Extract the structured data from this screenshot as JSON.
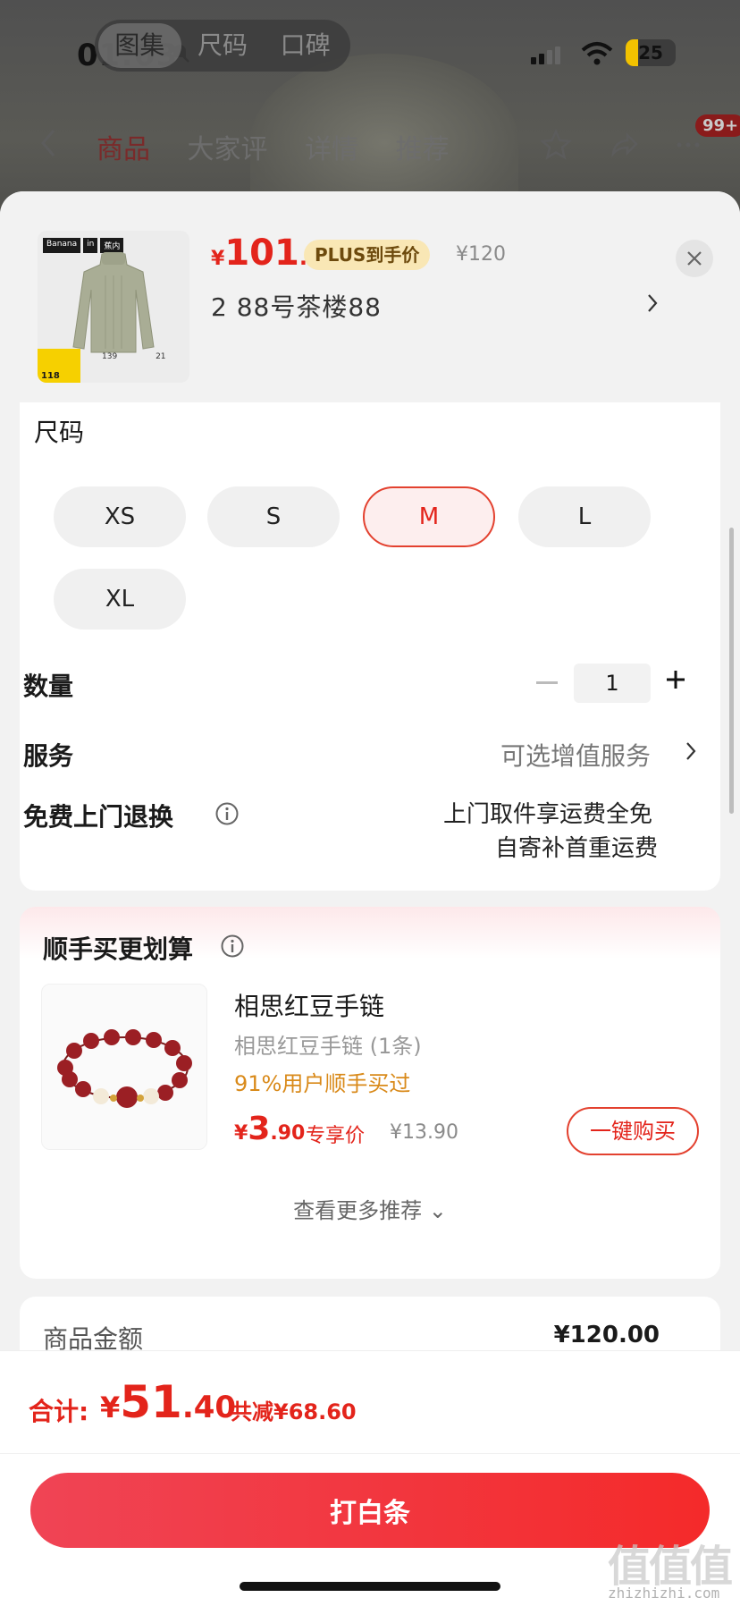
{
  "status": {
    "time": "01:03",
    "battery": "25"
  },
  "top_tabs": [
    "图集",
    "尺码",
    "口碑"
  ],
  "nav": {
    "tabs": [
      "商品",
      "大家评",
      "详情",
      "推荐"
    ],
    "badge": "99+"
  },
  "product": {
    "price_yen": "¥",
    "price_int": "101",
    "price_dec": ".4",
    "plus_tag": "PLUS到手价",
    "original_price": "¥120",
    "selected": "2  88号茶楼88",
    "thumb_brand": [
      "Banana",
      "in",
      "蕉内"
    ],
    "thumb_badge_price": "118",
    "thumb_info": [
      "139",
      "21"
    ]
  },
  "size": {
    "title": "尺码",
    "options": [
      "XS",
      "S",
      "M",
      "L",
      "XL"
    ],
    "selected": "M"
  },
  "quantity": {
    "label": "数量",
    "value": "1"
  },
  "service": {
    "label": "服务",
    "value": "可选增值服务"
  },
  "returns": {
    "label": "免费上门退换",
    "line1": "上门取件享运费全免",
    "line2": "自寄补首重运费"
  },
  "bundle": {
    "title": "顺手买更划算",
    "name": "相思红豆手链",
    "sub": "相思红豆手链 (1条)",
    "percent": "91%用户顺手买过",
    "price_yen": "¥",
    "price_int": "3",
    "price_dec": ".90",
    "price_tag": "专享价",
    "original": "¥13.90",
    "buy_label": "一键购买",
    "more": "查看更多推荐 ⌄"
  },
  "amount": {
    "label": "商品金额",
    "value": "¥120.00"
  },
  "footer": {
    "total_label": "合计:",
    "total_yen": "¥",
    "total_int": "51",
    "total_dec": ".40",
    "discount": "共减¥68.60",
    "pay_label": "打白条"
  },
  "watermark": {
    "glyphs": "值值值",
    "url": "zhizhizhi.com"
  },
  "colors": {
    "accent": "#e3241b",
    "plus_bg": "#f9e7b5",
    "bundle_gold": "#d98a1a"
  }
}
